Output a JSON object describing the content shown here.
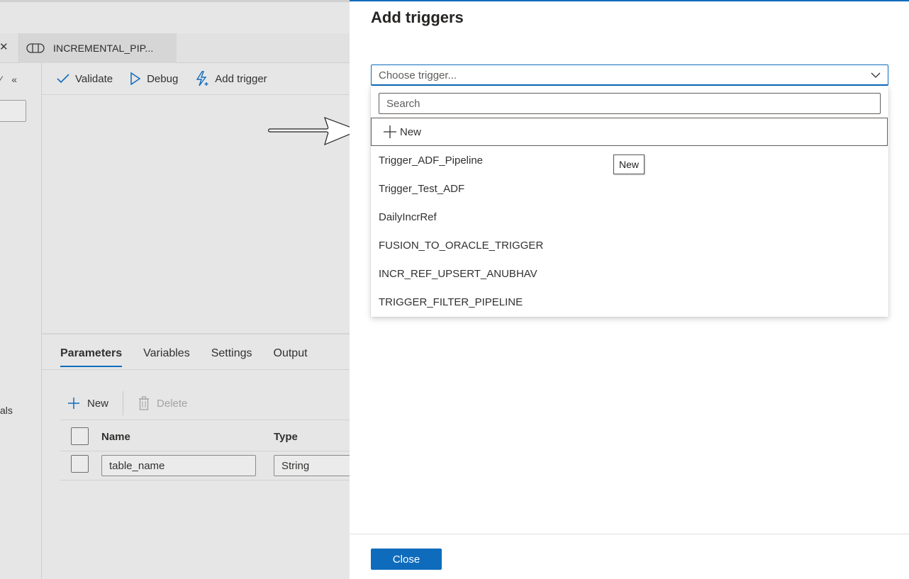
{
  "editor": {
    "tab_label": "INCREMENTAL_PIP...",
    "rail_text": "als",
    "toolbar": {
      "validate": "Validate",
      "debug": "Debug",
      "add_trigger": "Add trigger"
    },
    "panel_tabs": [
      "Parameters",
      "Variables",
      "Settings",
      "Output"
    ],
    "param_toolbar": {
      "new": "New",
      "delete": "Delete"
    },
    "grid": {
      "headers": {
        "name": "Name",
        "type": "Type"
      },
      "rows": [
        {
          "name": "table_name",
          "type": "String"
        }
      ]
    }
  },
  "flyout": {
    "title": "Add triggers",
    "combo_placeholder": "Choose trigger...",
    "search_placeholder": "Search",
    "new_label": "New",
    "triggers": [
      "Trigger_ADF_Pipeline",
      "Trigger_Test_ADF",
      "DailyIncrRef",
      "FUSION_TO_ORACLE_TRIGGER",
      "INCR_REF_UPSERT_ANUBHAV",
      "TRIGGER_FILTER_PIPELINE"
    ],
    "tooltip": "New",
    "close_label": "Close"
  },
  "colors": {
    "accent": "#0f6cbd"
  }
}
